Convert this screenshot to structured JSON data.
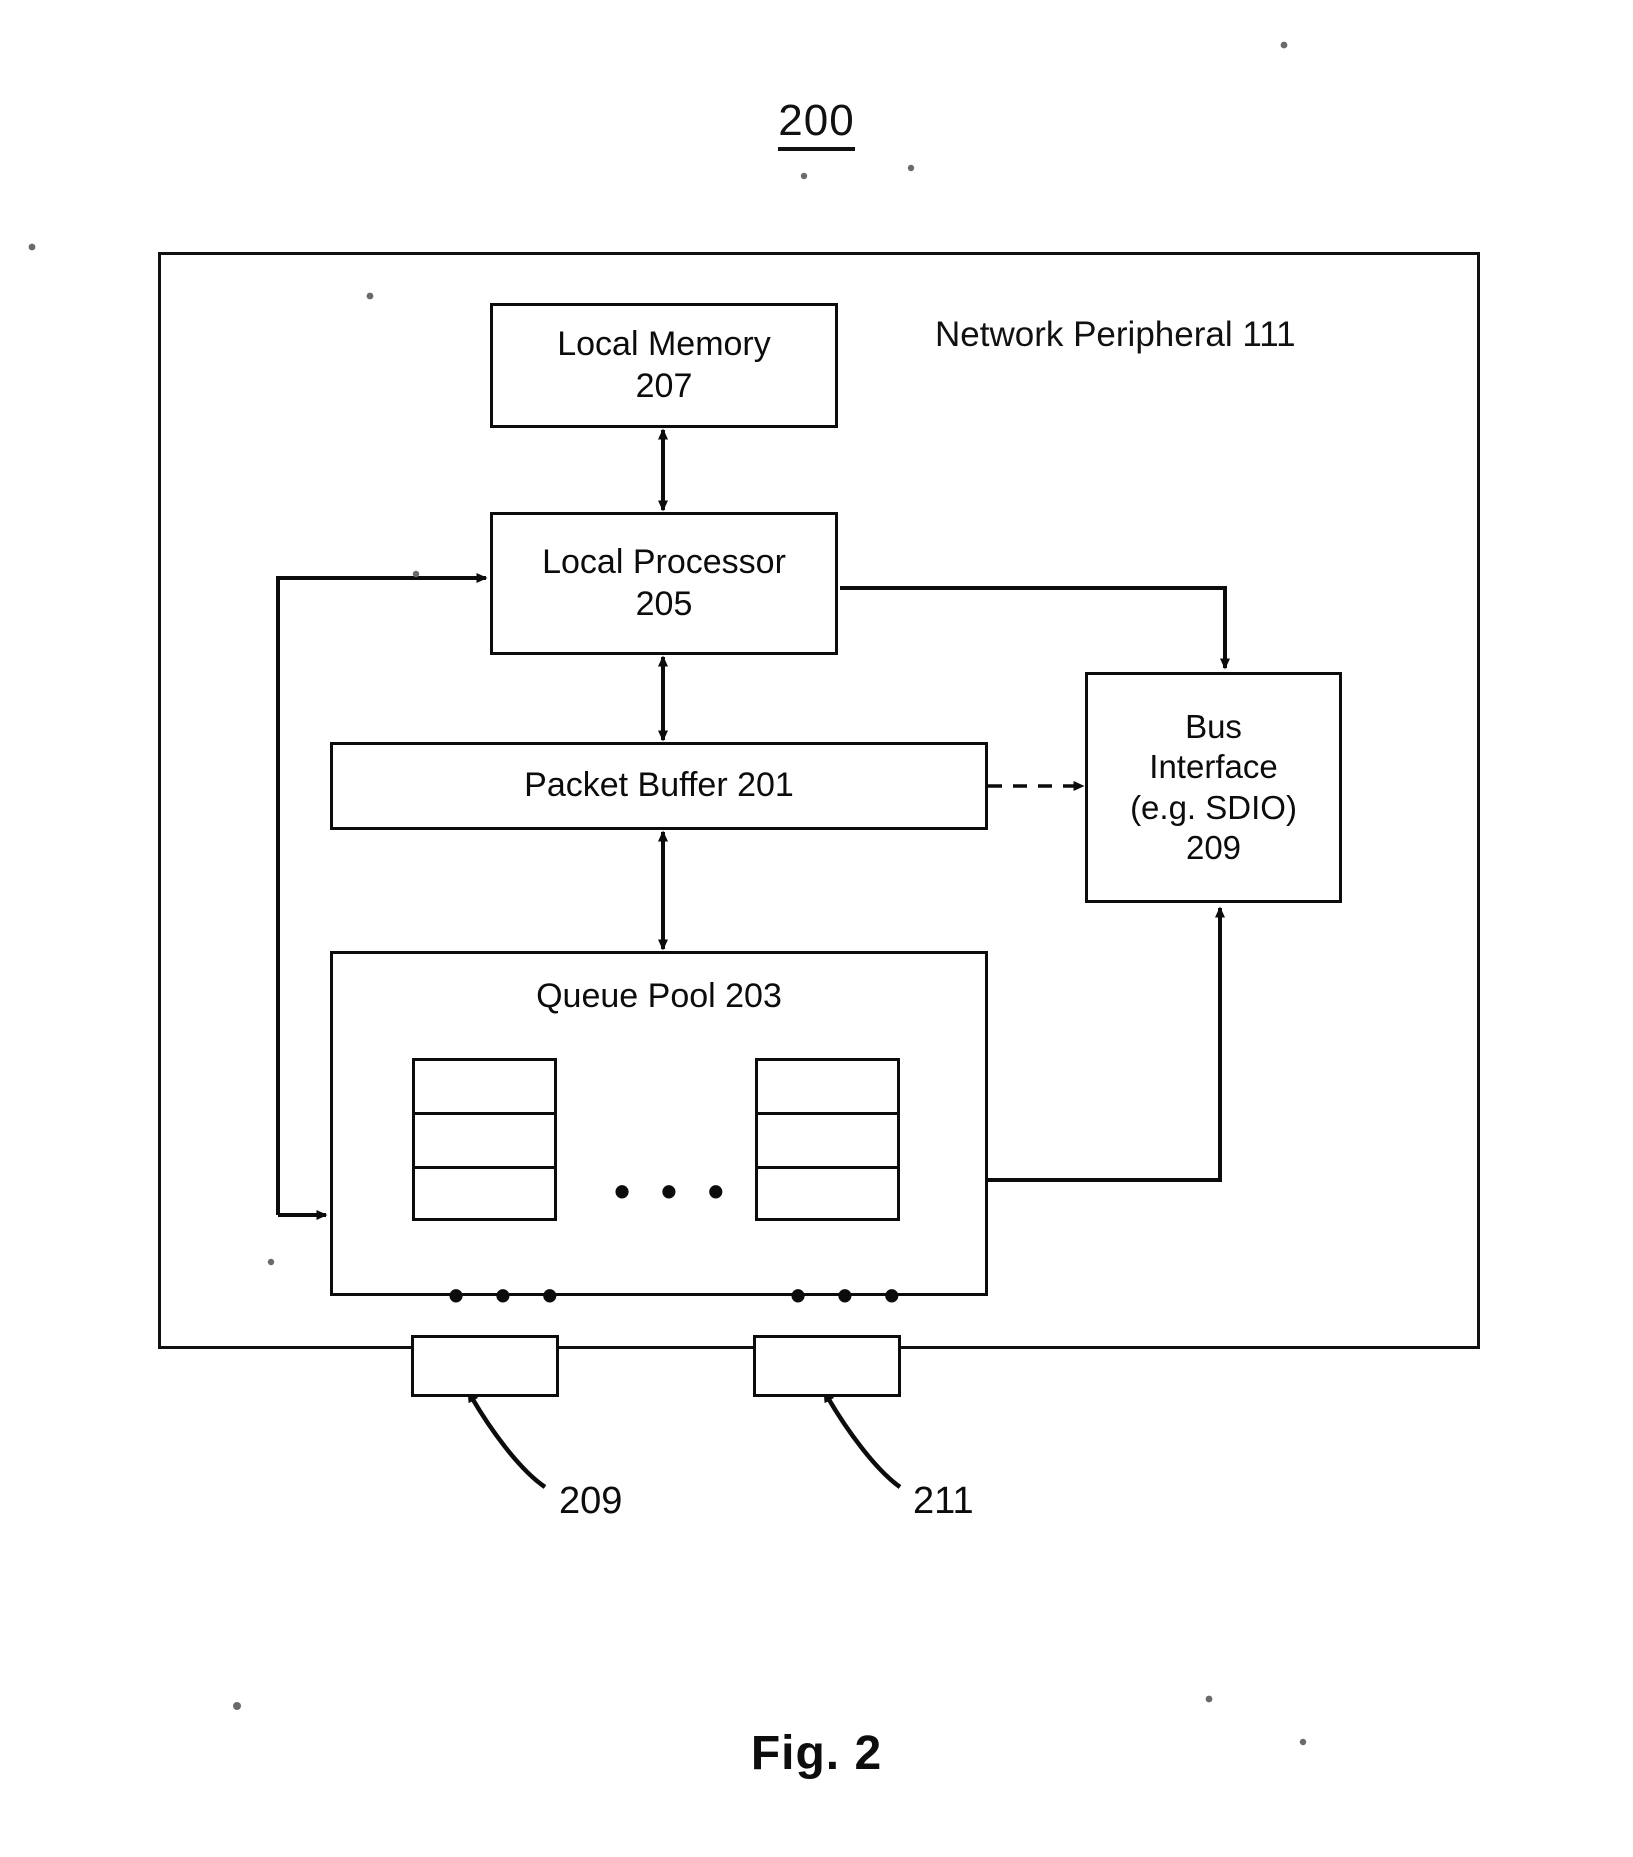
{
  "figure": {
    "number": "200",
    "caption": "Fig. 2"
  },
  "container": {
    "label": "Network Peripheral  111"
  },
  "nodes": {
    "local_memory": {
      "line1": "Local Memory",
      "line2": "207"
    },
    "local_processor": {
      "line1": "Local Processor",
      "line2": "205"
    },
    "packet_buffer": {
      "line1": "Packet Buffer 201"
    },
    "bus_interface": {
      "line1": "Bus",
      "line2": "Interface",
      "line3": "(e.g. SDIO)",
      "line4": "209"
    },
    "queue_pool": {
      "title": "Queue Pool 203"
    }
  },
  "ellipsis": {
    "middle": "• • •",
    "left_column": "• • •",
    "right_column": "• • •"
  },
  "callouts": {
    "left": "209",
    "right": "211"
  },
  "colors": {
    "ink": "#0c0c0c",
    "paper": "#ffffff"
  }
}
